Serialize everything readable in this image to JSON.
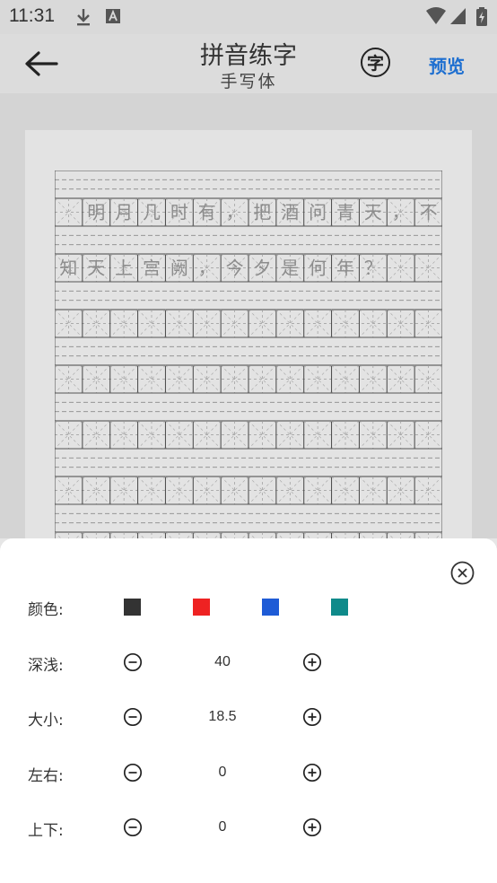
{
  "status": {
    "time": "11:31"
  },
  "header": {
    "title": "拼音练字",
    "subtitle": "手写体",
    "zi_button": "字",
    "preview_label": "预览"
  },
  "practice": {
    "line1": [
      "",
      "明",
      "月",
      "几",
      "时",
      "有",
      "，",
      "把",
      "酒",
      "问",
      "青",
      "天",
      "，",
      "不"
    ],
    "line2": [
      "知",
      "天",
      "上",
      "宫",
      "阙",
      "，",
      "今",
      "夕",
      "是",
      "何",
      "年",
      "？",
      "",
      ""
    ]
  },
  "settings": {
    "color": {
      "label": "颜色:",
      "options": [
        "#333333",
        "#ee2222",
        "#1e5bd6",
        "#0f8a8a"
      ]
    },
    "depth": {
      "label": "深浅:",
      "value": "40"
    },
    "size": {
      "label": "大小:",
      "value": "18.5"
    },
    "horizontal": {
      "label": "左右:",
      "value": "0"
    },
    "vertical": {
      "label": "上下:",
      "value": "0"
    }
  }
}
